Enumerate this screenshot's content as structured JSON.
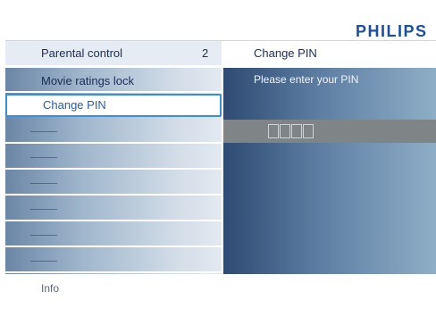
{
  "brand": {
    "logo": "PHILIPS"
  },
  "header": {
    "left_label": "Parental control",
    "left_value": "2",
    "right_label": "Change PIN"
  },
  "menu": {
    "items": [
      {
        "label": "Movie ratings lock",
        "selected": false
      },
      {
        "label": "Change PIN",
        "selected": true
      },
      {
        "label": "",
        "selected": false
      },
      {
        "label": "",
        "selected": false
      },
      {
        "label": "",
        "selected": false
      },
      {
        "label": "",
        "selected": false
      },
      {
        "label": "",
        "selected": false
      },
      {
        "label": "",
        "selected": false
      }
    ]
  },
  "panel": {
    "prompt": "Please enter your PIN",
    "pin_digits_total": 4,
    "pin_digits_entered": 0
  },
  "footer": {
    "info_label": "Info"
  },
  "colors": {
    "brand": "#1b4fa0",
    "selection_border": "#3b8fd9",
    "text": "#1b2d56"
  }
}
